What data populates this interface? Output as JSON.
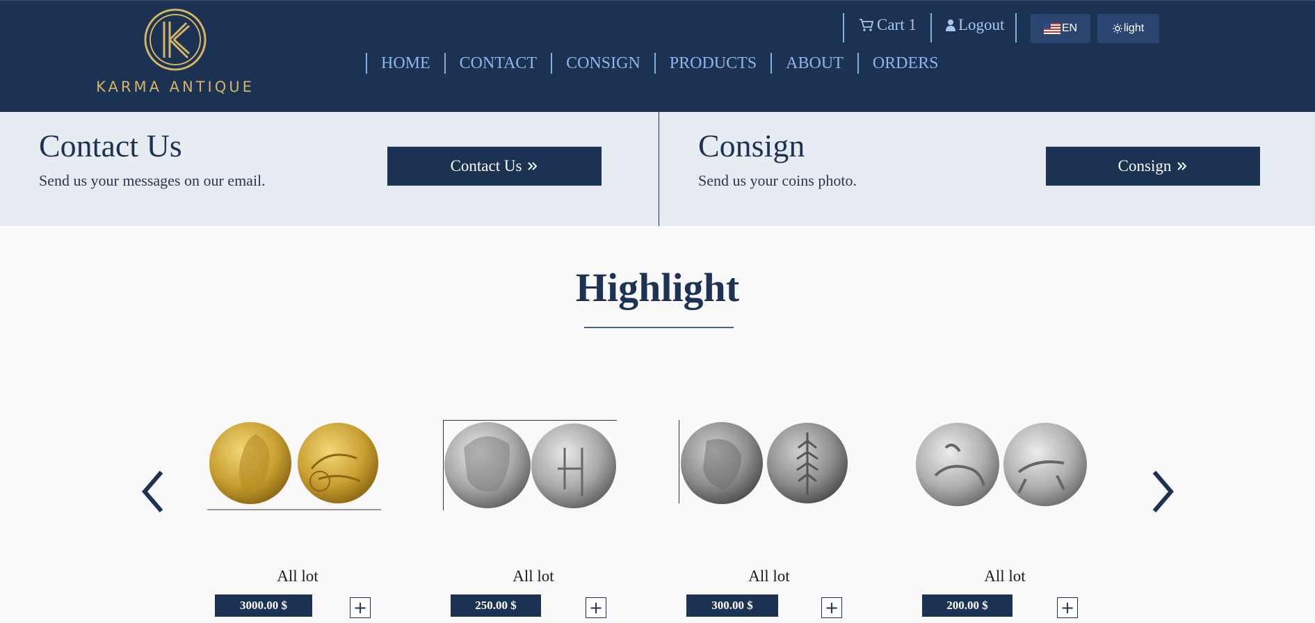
{
  "header": {
    "logo_text": "KARMA ANTIQUE",
    "cart_label": "Cart 1",
    "logout_label": "Logout",
    "lang_label": "EN",
    "theme_label": "light",
    "nav": [
      "HOME",
      "CONTACT",
      "CONSIGN",
      "PRODUCTS",
      "ABOUT",
      "ORDERS"
    ]
  },
  "banner": {
    "contact": {
      "title": "Contact Us",
      "subtitle": "Send us your messages on our email.",
      "button_label": "Contact Us"
    },
    "consign": {
      "title": "Consign",
      "subtitle": "Send us your coins photo.",
      "button_label": "Consign"
    }
  },
  "highlight": {
    "title": "Highlight",
    "products": [
      {
        "title": "All lot",
        "price": "3000.00 $",
        "metal": "gold"
      },
      {
        "title": "All lot",
        "price": "250.00 $",
        "metal": "silver"
      },
      {
        "title": "All lot",
        "price": "300.00 $",
        "metal": "silver-dark"
      },
      {
        "title": "All lot",
        "price": "200.00 $",
        "metal": "silver"
      }
    ]
  },
  "icons": {
    "cart": "cart-icon",
    "user": "user-icon",
    "flag": "us-flag-icon",
    "sun": "sun-icon",
    "chevrons": "double-chevron-right-icon",
    "prev": "chevron-left-icon",
    "next": "chevron-right-icon",
    "plus": "plus-icon"
  },
  "colors": {
    "navy": "#1c3253",
    "gold": "#d5b565",
    "nav_link": "#8fb4ee",
    "banner_bg": "#e7ecf3"
  }
}
